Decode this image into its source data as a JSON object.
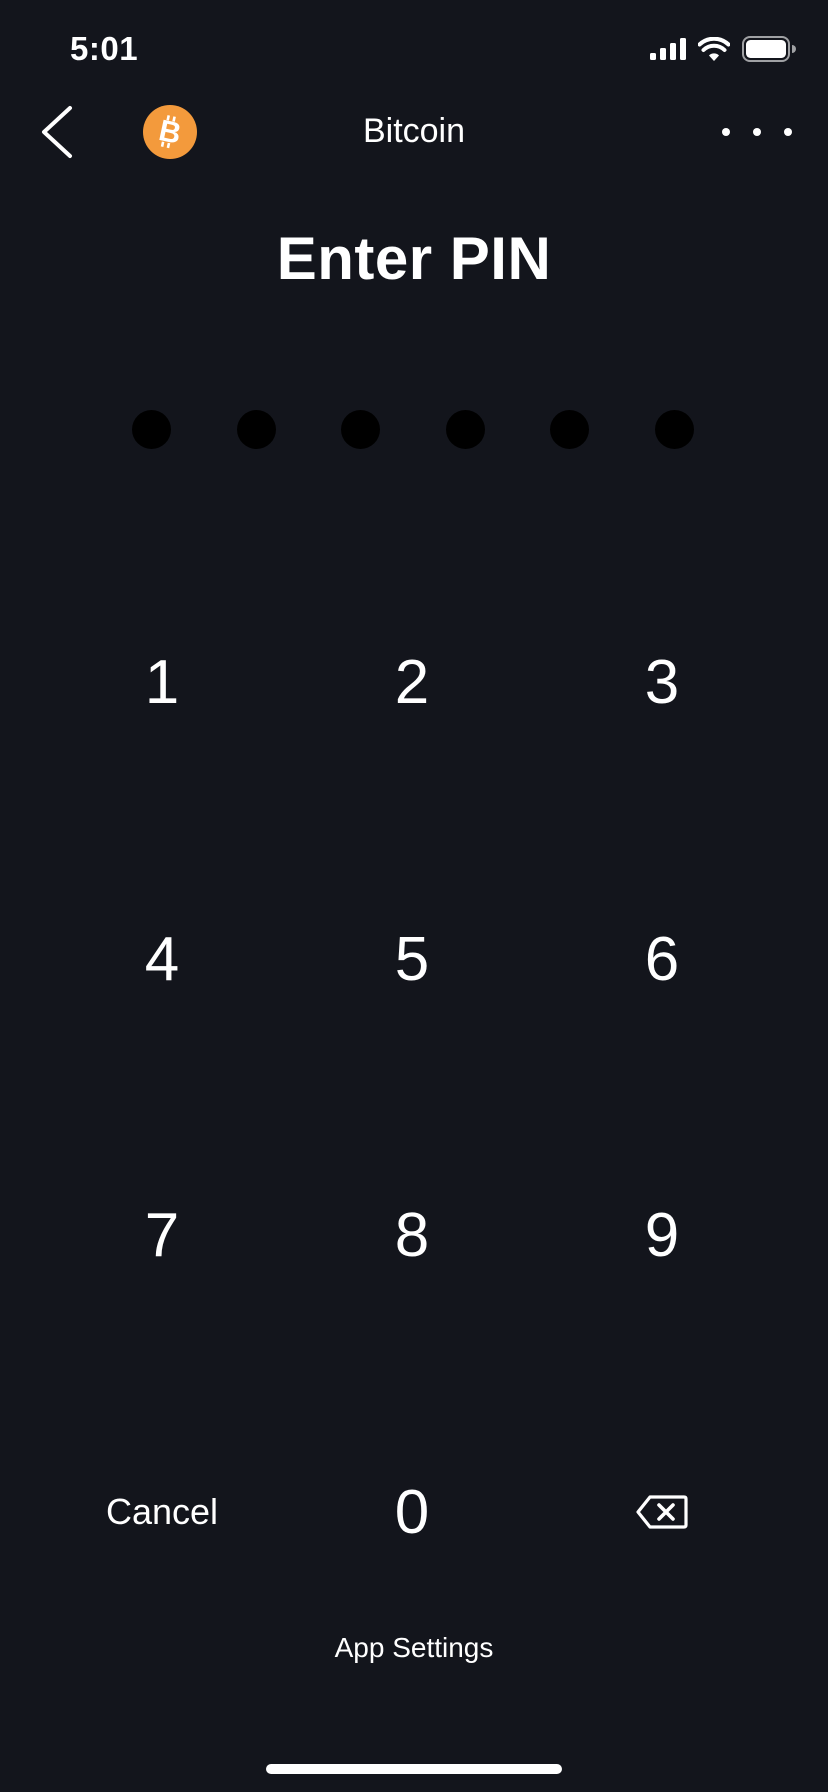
{
  "status_bar": {
    "time": "5:01",
    "icons": [
      "cellular-signal-icon",
      "wifi-icon",
      "battery-icon"
    ]
  },
  "nav": {
    "back_icon": "chevron-left-icon",
    "coin_icon": "bitcoin-icon",
    "title": "Bitcoin",
    "more_icon": "more-horizontal-icon"
  },
  "title": "Enter PIN",
  "pin": {
    "length": 6,
    "filled": 0,
    "dot_color": "#000000"
  },
  "keypad": {
    "keys": {
      "k1": "1",
      "k2": "2",
      "k3": "3",
      "k4": "4",
      "k5": "5",
      "k6": "6",
      "k7": "7",
      "k8": "8",
      "k9": "9",
      "k0": "0"
    },
    "cancel_label": "Cancel",
    "delete_icon": "backspace-icon"
  },
  "footer": {
    "app_settings_label": "App Settings"
  },
  "colors": {
    "background": "#13151c",
    "bitcoin_orange": "#f39a3c",
    "text": "#ffffff"
  }
}
